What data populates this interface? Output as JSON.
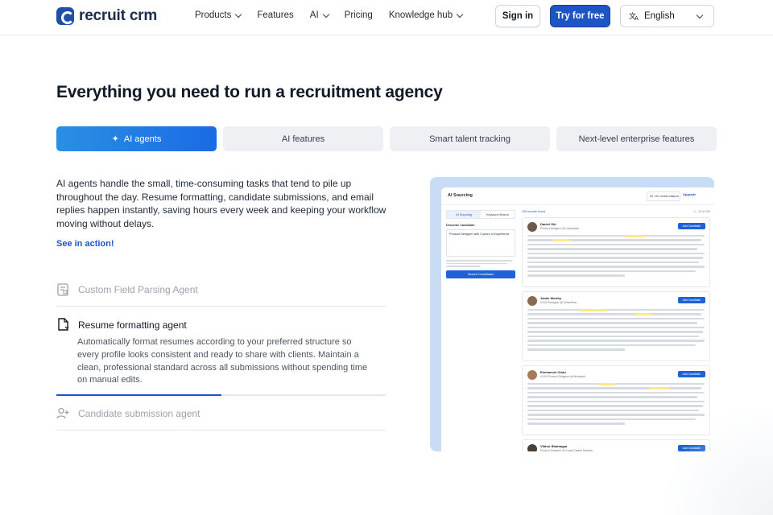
{
  "header": {
    "logo_text": "recruit crm",
    "nav": [
      {
        "label": "Products",
        "dropdown": true
      },
      {
        "label": "Features",
        "dropdown": false
      },
      {
        "label": "AI",
        "dropdown": true
      },
      {
        "label": "Pricing",
        "dropdown": false
      },
      {
        "label": "Knowledge hub",
        "dropdown": true
      }
    ],
    "sign_in": "Sign in",
    "try_free": "Try for free",
    "language": "English"
  },
  "main": {
    "title": "Everything you need to run a recruitment agency",
    "tabs": [
      {
        "label": "AI agents",
        "active": true,
        "icon": "sparkle-icon"
      },
      {
        "label": "AI features",
        "active": false
      },
      {
        "label": "Smart talent tracking",
        "active": false
      },
      {
        "label": "Next-level enterprise features",
        "active": false
      }
    ],
    "description": "AI agents handle the small, time-consuming tasks that tend to pile up throughout the day. Resume formatting, candidate submissions, and email replies happen instantly, saving hours every week and keeping your workflow moving without delays.",
    "see_link": "See in action!",
    "agents": [
      {
        "title": "Custom Field Parsing Agent",
        "icon": "document-parse-icon",
        "open": false
      },
      {
        "title": "Resume formatting agent",
        "icon": "document-format-icon",
        "open": true,
        "text": "Automatically format resumes according to your preferred structure so every profile looks consistent and ready to share with clients. Maintain a clean, professional standard across all submissions without spending time on manual edits."
      },
      {
        "title": "Candidate submission agent",
        "icon": "user-add-icon",
        "open": false
      }
    ],
    "progress": 0.5
  },
  "mock": {
    "title": "AI Sourcing",
    "credits": "50 / 50 credits balance",
    "upgrade": "Upgrade",
    "tabs": [
      "AI Sourcing",
      "Keyword Search"
    ],
    "describe_label": "Describe Candidate",
    "query": "Product Designer with 3 years of experience",
    "search_button": "Search Candidates",
    "found": "100 records found",
    "pagination": "1 - 10 of 100",
    "add_label": "Add Candidate",
    "candidates": [
      {
        "name": "Daniel Oki",
        "role": "Product Designer @ Landscastr"
      },
      {
        "name": "Jamie Worthy",
        "role": "UX/UI Designer @ Dreamflow"
      },
      {
        "name": "Emmanuel Olotu",
        "role": "UX/UI Product Designer @ Micratech"
      },
      {
        "name": "Vibhor Bhatnagar",
        "role": "Product Designer @ Coast Capital Savings"
      }
    ]
  }
}
